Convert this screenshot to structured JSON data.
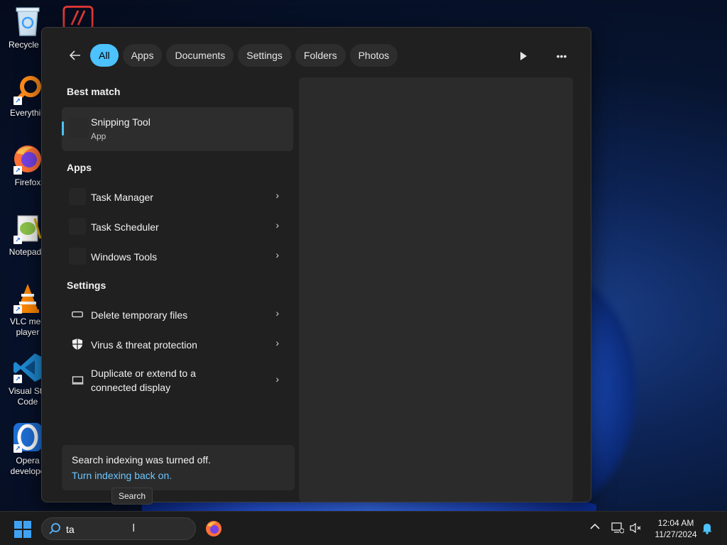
{
  "desktop": {
    "icons": [
      {
        "label": "Recycle B",
        "icon": "recycle-bin-icon"
      },
      {
        "label": "Everythin",
        "icon": "everything-search-icon"
      },
      {
        "label": "Firefox",
        "icon": "firefox-icon"
      },
      {
        "label": "Notepad+",
        "icon": "notepad-plus-plus-icon"
      },
      {
        "label_line1": "VLC med",
        "label_line2": "player",
        "icon": "vlc-icon"
      },
      {
        "label_line1": "Visual Stu",
        "label_line2": "Code",
        "icon": "vscode-icon"
      },
      {
        "label_line1": "Opera",
        "label_line2": "develope",
        "icon": "opera-icon"
      }
    ]
  },
  "search_panel": {
    "filters": [
      "All",
      "Apps",
      "Documents",
      "Settings",
      "Folders",
      "Photos"
    ],
    "active_filter": "All",
    "sections": {
      "best_match": "Best match",
      "apps": "Apps",
      "settings": "Settings"
    },
    "best_match": {
      "name": "Snipping Tool",
      "type": "App"
    },
    "apps": [
      {
        "label": "Task Manager"
      },
      {
        "label": "Task Scheduler"
      },
      {
        "label": "Windows Tools"
      }
    ],
    "settings": [
      {
        "label": "Delete temporary files",
        "icon": "storage-drive-icon"
      },
      {
        "label": "Virus & threat protection",
        "icon": "shield-icon"
      },
      {
        "label_line1": "Duplicate or extend to a",
        "label_line2": "connected display",
        "icon": "monitor-icon"
      }
    ],
    "indexing": {
      "message": "Search indexing was turned off.",
      "link": "Turn indexing back on."
    },
    "tooltip": "Search"
  },
  "taskbar": {
    "search_value": "ta",
    "time": "12:04 AM",
    "date": "11/27/2024"
  },
  "colors": {
    "accent": "#4cc2ff",
    "panel_bg": "#202020",
    "link": "#6cc6ff"
  }
}
